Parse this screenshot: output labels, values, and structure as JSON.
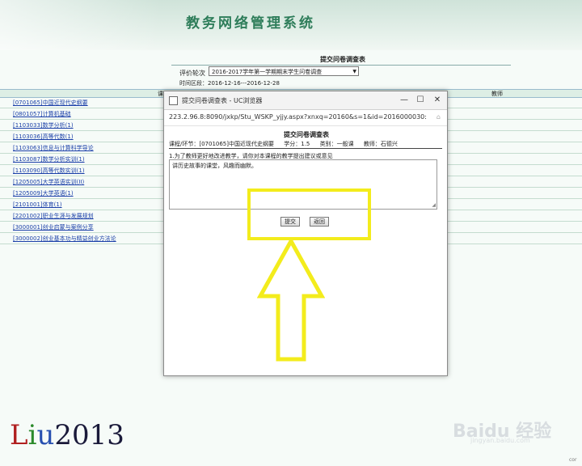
{
  "header": {
    "title": "教务网络管理系统"
  },
  "survey": {
    "title": "提交问卷调查表",
    "round_label": "评价轮次",
    "round_value": "2016-2017学年第一学期期末学生问卷调查",
    "range": "时间区段：2016-12-16---2016-12-28"
  },
  "table": {
    "col_course": "课程",
    "col_teacher": "教师",
    "rows": [
      "[0701065]中国近现代史纲要",
      "[0801057]计算机基础",
      "[1103033]数学分析(1)",
      "[1103036]高等代数(1)",
      "[1103063]信息与计算科学导论",
      "[1103087]数学分析实训(1)",
      "[1103090]高等代数实训(1)",
      "[1205005]大学英语实训(II)",
      "[1205009]大学英语(1)",
      "[2101001]体育(1)",
      "[2201002]职业生涯与发展规划",
      "[3000001]创业启蒙与案例分享",
      "[3000002]创业基本功与精益创业方法论"
    ]
  },
  "dialog": {
    "window_title": "提交问卷调查表 - UC浏览器",
    "url": "223.2.96.8:8090/jxkp/Stu_WSKP_yjjy.aspx?xnxq=20160&s=1&id=2016000030:",
    "form_title": "提交问卷调查表",
    "course_info": "课程/环节：[0701065]中国近现代史纲要",
    "credit": "学分：1.5",
    "category": "类别：一般课",
    "teacher": "教师：石德兴",
    "question": "1.为了教师更好地改进教学，请你对本课程的教学提出建议或意见",
    "answer": "讲历史故事的课堂，风趣而幽默。",
    "submit_label": "提交",
    "back_label": "返回"
  },
  "watermark": {
    "baidu": "Baidu 经验",
    "url": "jingyan.baidu.com",
    "signature_l": "L",
    "signature_i": "i",
    "signature_u": "u",
    "signature_year": "2013",
    "corner": "cor"
  },
  "colors": {
    "highlight": "#f3ec1c",
    "header_text": "#2e7d5a",
    "link": "#1a3fa8"
  }
}
